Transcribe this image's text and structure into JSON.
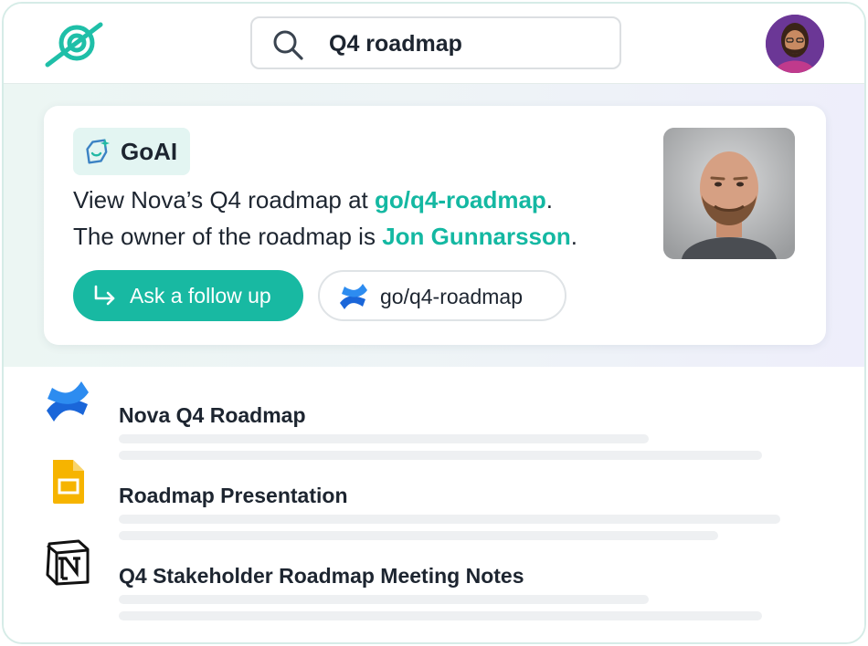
{
  "search": {
    "query": "Q4 roadmap"
  },
  "answer": {
    "badge_label": "GoAI",
    "line1_prefix": "View Nova’s Q4 roadmap at ",
    "line1_link": "go/q4-roadmap",
    "line1_suffix": ".",
    "line2_prefix": "The owner of the roadmap is ",
    "line2_person": "Jon Gunnarsson",
    "line2_suffix": ".",
    "followup_label": "Ask a follow up",
    "link_button_label": "go/q4-roadmap"
  },
  "results": [
    {
      "title": "Nova Q4 Roadmap",
      "icon": "confluence-icon"
    },
    {
      "title": "Roadmap Presentation",
      "icon": "google-slides-icon"
    },
    {
      "title": "Q4 Stakeholder Roadmap Meeting Notes",
      "icon": "notion-icon"
    }
  ],
  "colors": {
    "accent": "#18b9a2",
    "link": "#14b8a2",
    "text": "#1d2530",
    "badge_bg": "#e3f5f2"
  }
}
